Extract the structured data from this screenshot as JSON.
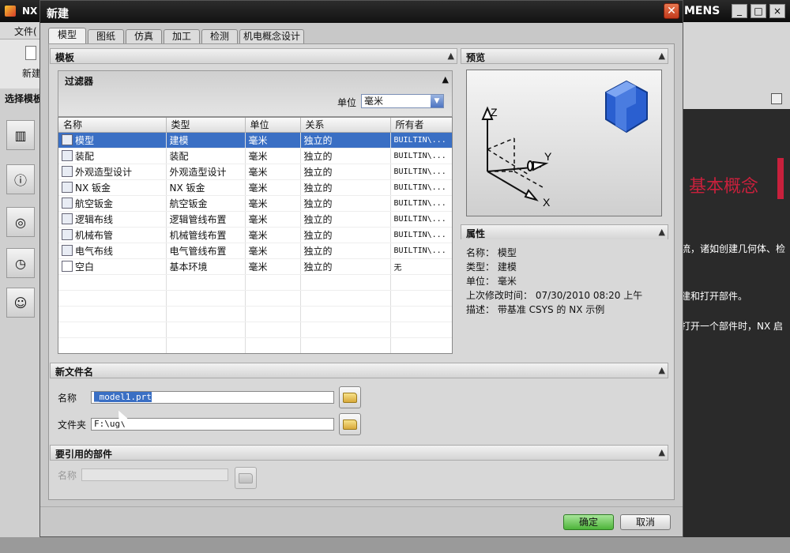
{
  "background_app": {
    "logo_text": "NX",
    "brand_fragment": "MENS",
    "menu_file": "文件(",
    "toolbar_new": "新建",
    "template_select_label": "选择模板",
    "right_heading": "基本概念",
    "right_text_lines": [
      "流，诸如创建几何体、检",
      "建和打开部件。",
      "打开一个部件时，NX 启"
    ],
    "window_buttons": [
      "_",
      "□",
      "×"
    ],
    "left_icons": [
      "books-icon",
      "info-icon",
      "web-icon",
      "clock-icon",
      "users-icon"
    ]
  },
  "dialog": {
    "title": "新建",
    "tabs": [
      {
        "label": "模型",
        "active": true
      },
      {
        "label": "图纸",
        "active": false
      },
      {
        "label": "仿真",
        "active": false
      },
      {
        "label": "加工",
        "active": false
      },
      {
        "label": "检测",
        "active": false
      },
      {
        "label": "机电概念设计",
        "active": false
      }
    ],
    "template_section": {
      "title": "模板",
      "filter": {
        "title": "过滤器",
        "unit_label": "单位",
        "unit_value": "毫米"
      },
      "columns": [
        "名称",
        "类型",
        "单位",
        "关系",
        "所有者"
      ],
      "rows": [
        {
          "name": "模型",
          "type": "建模",
          "unit": "毫米",
          "relation": "独立的",
          "owner": "BUILTIN\\...",
          "selected": true
        },
        {
          "name": "装配",
          "type": "装配",
          "unit": "毫米",
          "relation": "独立的",
          "owner": "BUILTIN\\...",
          "selected": false
        },
        {
          "name": "外观造型设计",
          "type": "外观造型设计",
          "unit": "毫米",
          "relation": "独立的",
          "owner": "BUILTIN\\...",
          "selected": false
        },
        {
          "name": "NX 钣金",
          "type": "NX 钣金",
          "unit": "毫米",
          "relation": "独立的",
          "owner": "BUILTIN\\...",
          "selected": false
        },
        {
          "name": "航空钣金",
          "type": "航空钣金",
          "unit": "毫米",
          "relation": "独立的",
          "owner": "BUILTIN\\...",
          "selected": false
        },
        {
          "name": "逻辑布线",
          "type": "逻辑管线布置",
          "unit": "毫米",
          "relation": "独立的",
          "owner": "BUILTIN\\...",
          "selected": false
        },
        {
          "name": "机械布管",
          "type": "机械管线布置",
          "unit": "毫米",
          "relation": "独立的",
          "owner": "BUILTIN\\...",
          "selected": false
        },
        {
          "name": "电气布线",
          "type": "电气管线布置",
          "unit": "毫米",
          "relation": "独立的",
          "owner": "BUILTIN\\...",
          "selected": false
        },
        {
          "name": "空白",
          "type": "基本环境",
          "unit": "毫米",
          "relation": "独立的",
          "owner": "无",
          "selected": false
        }
      ]
    },
    "preview_section": {
      "title": "预览",
      "axis_labels": {
        "z": "Z",
        "y": "Y",
        "x": "X"
      }
    },
    "properties_section": {
      "title": "属性",
      "items": [
        {
          "label": "名称：",
          "value": "模型"
        },
        {
          "label": "类型：",
          "value": "建模"
        },
        {
          "label": "单位：",
          "value": "毫米"
        },
        {
          "label": "上次修改时间：",
          "value": "07/30/2010 08:20 上午"
        },
        {
          "label": "描述：",
          "value": "带基准 CSYS 的 NX 示例"
        }
      ]
    },
    "new_file_section": {
      "title": "新文件名",
      "name_label": "名称",
      "name_value": "_model1.prt",
      "folder_label": "文件夹",
      "folder_value": "F:\\ug\\"
    },
    "ref_parts_section": {
      "title": "要引用的部件",
      "name_label": "名称",
      "name_value": ""
    },
    "ok_label": "确定",
    "cancel_label": "取消"
  }
}
